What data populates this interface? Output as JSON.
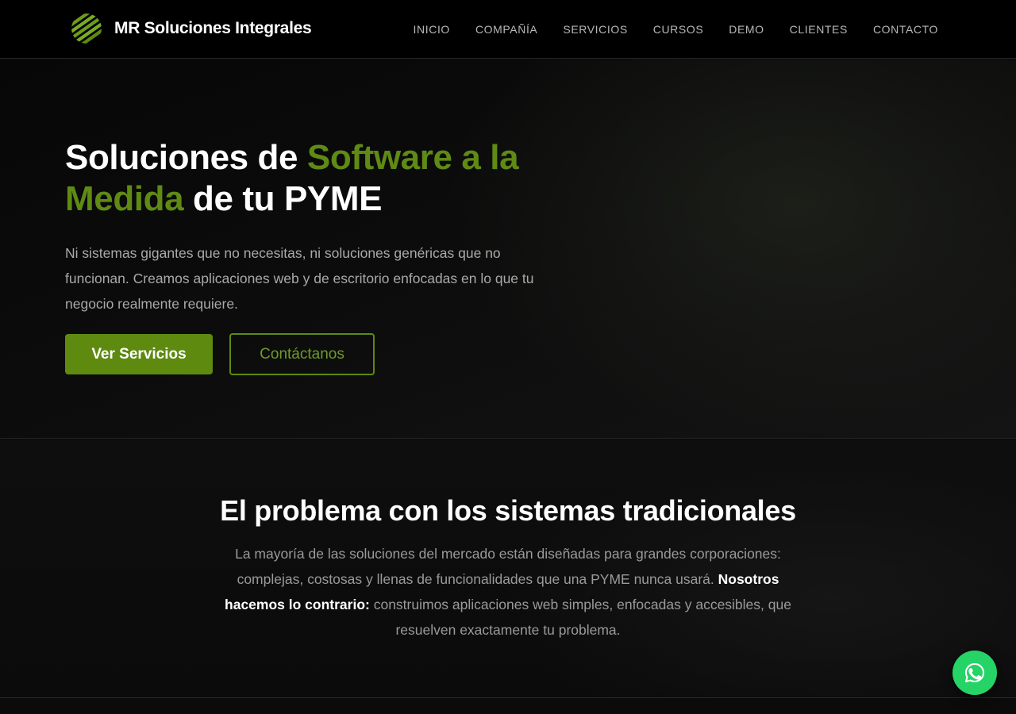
{
  "header": {
    "brand_name": "MR Soluciones Integrales",
    "logo_icon": "striped-globe-logo",
    "nav": [
      {
        "label": "INICIO"
      },
      {
        "label": "COMPAÑÍA"
      },
      {
        "label": "SERVICIOS"
      },
      {
        "label": "CURSOS"
      },
      {
        "label": "DEMO"
      },
      {
        "label": "CLIENTES"
      },
      {
        "label": "CONTACTO"
      }
    ]
  },
  "hero": {
    "title_part1": "Soluciones de ",
    "title_accent1": "Software a la Medida",
    "title_part2": " de tu PYME",
    "description": "Ni sistemas gigantes que no necesitas, ni soluciones genéricas que no funcionan. Creamos aplicaciones web y de escritorio enfocadas en lo que tu negocio realmente requiere.",
    "primary_button": "Ver Servicios",
    "secondary_button": "Contáctanos"
  },
  "problem": {
    "title": "El problema con los sistemas tradicionales",
    "text_part1": "La mayoría de las soluciones del mercado están diseñadas para grandes corporaciones: complejas, costosas y llenas de funcionalidades que una PYME nunca usará. ",
    "text_strong": "Nosotros hacemos lo contrario:",
    "text_part2": " construimos aplicaciones web simples, enfocadas y accesibles, que resuelven exactamente tu problema."
  },
  "floating": {
    "whatsapp_icon": "whatsapp-icon"
  },
  "colors": {
    "accent": "#5e8a10",
    "background": "#0a0a0a",
    "header_bg": "#000000",
    "whatsapp": "#25d366"
  }
}
